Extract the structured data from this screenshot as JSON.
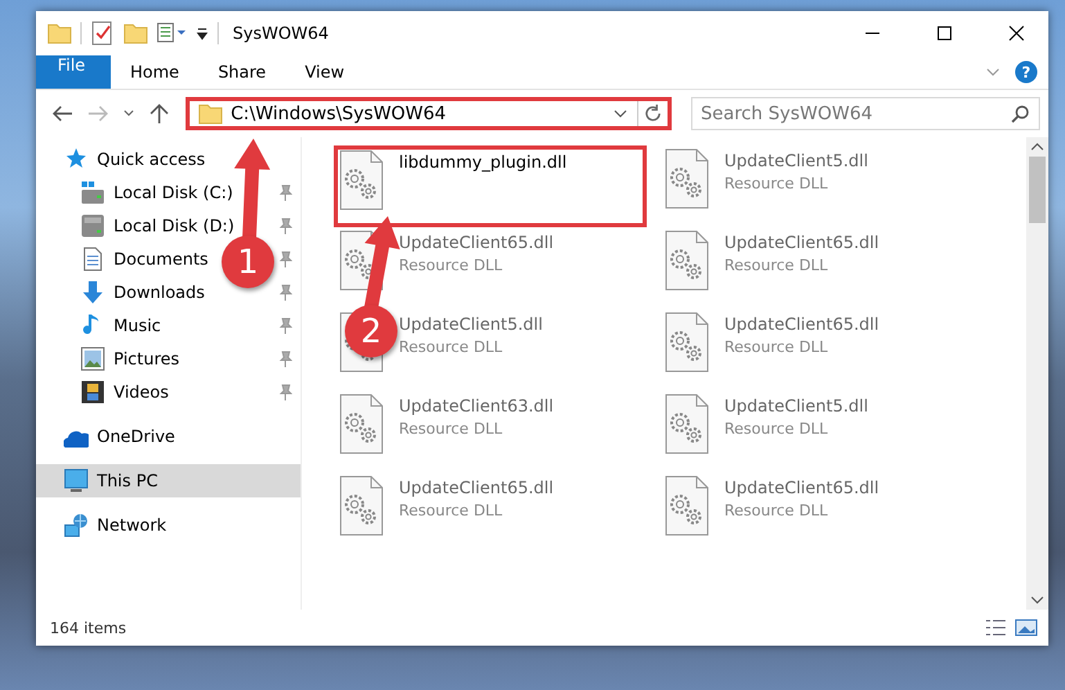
{
  "window": {
    "title": "SysWOW64"
  },
  "ribbon": {
    "tabs": [
      {
        "label": "File",
        "kind": "file"
      },
      {
        "label": "Home",
        "kind": "tab"
      },
      {
        "label": "Share",
        "kind": "tab"
      },
      {
        "label": "View",
        "kind": "tab"
      }
    ],
    "help": "?"
  },
  "address_bar": {
    "path": "C:\\Windows\\SysWOW64",
    "highlighted": true
  },
  "search": {
    "placeholder": "Search SysWOW64"
  },
  "navigation": [
    {
      "label": "Quick access",
      "kind": "star",
      "selected": false,
      "children": [
        {
          "label": "Local Disk (C:)",
          "kind": "systemdrive",
          "pinned": true,
          "selected": false
        },
        {
          "label": "Local Disk (D:)",
          "kind": "drive",
          "pinned": true,
          "selected": false
        },
        {
          "label": "Documents",
          "kind": "documents",
          "pinned": true,
          "selected": false
        },
        {
          "label": "Downloads",
          "kind": "downloads",
          "pinned": true,
          "selected": false
        },
        {
          "label": "Music",
          "kind": "music",
          "pinned": true,
          "selected": false
        },
        {
          "label": "Pictures",
          "kind": "pictures",
          "pinned": true,
          "selected": false
        },
        {
          "label": "Videos",
          "kind": "videos",
          "pinned": true,
          "selected": false
        }
      ]
    },
    {
      "label": "OneDrive",
      "kind": "cloud",
      "selected": false
    },
    {
      "label": "This PC",
      "kind": "computer",
      "selected": true
    },
    {
      "label": "Network",
      "kind": "network",
      "selected": false
    }
  ],
  "files": [
    {
      "name": "libdummy_plugin.dll",
      "highlighted": true
    },
    {
      "name": "UpdateClient5.dll",
      "type": "Resource DLL",
      "highlighted": false
    },
    {
      "name": "UpdateClient65.dll",
      "type": "Resource DLL",
      "highlighted": false
    },
    {
      "name": "UpdateClient65.dll",
      "type": "Resource DLL",
      "highlighted": false
    },
    {
      "name": "UpdateClient5.dll",
      "type": "Resource DLL",
      "highlighted": false
    },
    {
      "name": "UpdateClient65.dll",
      "type": "Resource DLL",
      "highlighted": false
    },
    {
      "name": "UpdateClient63.dll",
      "type": "Resource DLL",
      "highlighted": false
    },
    {
      "name": "UpdateClient5.dll",
      "type": "Resource DLL",
      "highlighted": false
    },
    {
      "name": "UpdateClient65.dll",
      "type": "Resource DLL",
      "highlighted": false
    },
    {
      "name": "UpdateClient65.dll",
      "type": "Resource DLL",
      "highlighted": false
    }
  ],
  "status_bar": {
    "item_count": "164 items"
  },
  "annotations": [
    {
      "number": "1"
    },
    {
      "number": "2"
    }
  ]
}
